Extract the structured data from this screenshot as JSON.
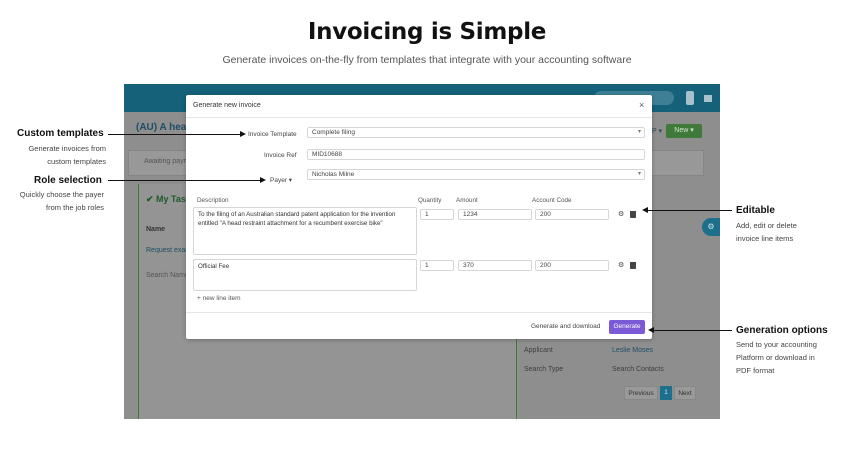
{
  "hero": {
    "title": "Invoicing is Simple",
    "subtitle": "Generate invoices on-the-fly from templates that integrate with your accounting software"
  },
  "app": {
    "title": "(AU) A head r",
    "new_label": "New ▾",
    "p_label": "P ▾",
    "awaiting": "Awaiting paym",
    "my_tasks": "✔ My Task",
    "name_col": "Name",
    "request": "Request exan",
    "search_name": "Search Name",
    "applicant_label": "Applicant",
    "applicant_value": "Leslie Moses",
    "search_type_label": "Search Type",
    "search_contacts": "Search Contacts",
    "prev": "Previous",
    "page": "1",
    "next": "Next"
  },
  "modal": {
    "title": "Generate new invoice",
    "close": "×",
    "template_label": "Invoice Template",
    "template_value": "Complete filing",
    "ref_label": "Invoice Ref",
    "ref_value": "MID10688",
    "payer_label": "Payer ▾",
    "payer_value": "Nicholas Milne",
    "columns": {
      "description": "Description",
      "quantity": "Quantity",
      "amount": "Amount",
      "account_code": "Account Code"
    },
    "line_items": [
      {
        "description": "To the filing of an Australian standard patent application for the invention entitled \"A head restraint attachment for a recumbent exercise bike\"",
        "quantity": "1",
        "amount": "1234",
        "account_code": "200"
      },
      {
        "description": "Official Fee",
        "quantity": "1",
        "amount": "370",
        "account_code": "200"
      }
    ],
    "new_line": "+ new line item",
    "generate_download": "Generate and download",
    "generate": "Generate"
  },
  "annotations": {
    "custom_templates": {
      "title": "Custom templates",
      "text": [
        "Generate invoices from",
        "custom templates"
      ]
    },
    "role_selection": {
      "title": "Role selection",
      "text": [
        "Quickly choose the payer",
        "from the job roles"
      ]
    },
    "editable": {
      "title": "Editable",
      "text": [
        "Add, edit or delete",
        "invoice line items"
      ]
    },
    "generation_options": {
      "title": "Generation options",
      "text": [
        "Send to your accounting",
        "Platform or download in",
        "PDF format"
      ]
    }
  },
  "colors": {
    "accent": "#7b5ad6",
    "app_header": "#15617a",
    "overlay": "#8e8e8e"
  },
  "icons": [
    "gear-icon",
    "trash-icon",
    "close-icon",
    "chevron-down-icon"
  ]
}
